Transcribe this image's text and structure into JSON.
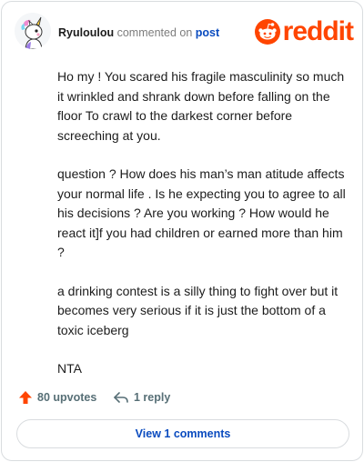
{
  "header": {
    "username": "Ryuloulou",
    "action_text": "commented on",
    "target_link": "post",
    "brand": "reddit"
  },
  "comment": {
    "paragraphs": [
      "Ho my ! You scared his fragile masculinity so much it wrinkled and shrank down before falling on the floor To crawl to the darkest corner before screeching at you.",
      "question ? How does his man’s man atitude affects your normal life . Is he expecting you to agree to all his decisions ? Are you working ? How would he react it]f you had children or earned more than him ?",
      "a drinking contest is a silly thing to fight over but it becomes very serious if it is just the bottom of a toxic iceberg",
      "NTA"
    ]
  },
  "actions": {
    "upvotes_label": "80 upvotes",
    "reply_label": "1 reply",
    "view_comments_label": "View 1 comments"
  },
  "colors": {
    "brand": "#ff4500",
    "link": "#0a4bbf",
    "muted": "#576f76"
  },
  "icons": {
    "avatar": "unicorn-avatar",
    "brand": "reddit-snoo-icon",
    "upvote": "upvote-arrow-icon",
    "reply": "reply-arrow-icon"
  }
}
